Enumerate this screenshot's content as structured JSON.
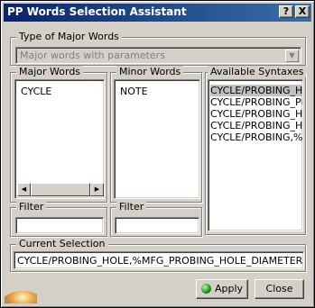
{
  "window": {
    "title": "PP Words Selection Assistant",
    "help_label": "?",
    "close_label": "X"
  },
  "type_group": {
    "label": "Type of Major Words",
    "selected": "Major words with parameters"
  },
  "major_words": {
    "label": "Major Words",
    "items": [
      "CYCLE"
    ]
  },
  "minor_words": {
    "label": "Minor Words",
    "items": [
      "NOTE"
    ]
  },
  "available_syntaxes": {
    "label": "Available Syntaxes",
    "items": [
      "CYCLE/PROBING_HO",
      "CYCLE/PROBING_PIN",
      "CYCLE/PROBING_HO",
      "CYCLE/PROBING_HO",
      "CYCLE/PROBING,%M"
    ]
  },
  "filters": {
    "major_label": "Filter",
    "major_value": "",
    "minor_label": "Filter",
    "minor_value": ""
  },
  "current_selection": {
    "label": "Current Selection",
    "value": "CYCLE/PROBING_HOLE,%MFG_PROBING_HOLE_DIAMETER,%MF"
  },
  "buttons": {
    "apply": "Apply",
    "close": "Close"
  },
  "colors": {
    "titlebar_start": "#0a246a",
    "titlebar_end": "#3a6ea5",
    "face": "#d4d0c8"
  }
}
